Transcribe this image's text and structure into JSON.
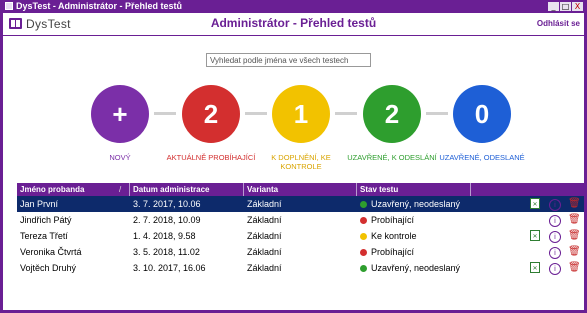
{
  "window": {
    "title": "DysTest - Administrátor - Přehled testů",
    "buttons": {
      "minimize": "_",
      "maximize": "□",
      "close": "X"
    }
  },
  "header": {
    "logo": "DysTest",
    "title": "Administrátor - Přehled testů",
    "logout": "Odhlásit se"
  },
  "search": {
    "placeholder": "Vyhledat podle jména ve všech testech",
    "value": ""
  },
  "status_steps": [
    {
      "symbol": "+",
      "label": "NOVÝ",
      "color": "#7b2fa8",
      "label_color": "#7b2fa8"
    },
    {
      "symbol": "2",
      "label": "AKTUÁLNĚ PROBÍHAJÍCÍ",
      "color": "#d32f2f",
      "label_color": "#d32f2f"
    },
    {
      "symbol": "1",
      "label": "K DOPLNĚNÍ, KE KONTROLE",
      "color": "#f2c200",
      "label_color": "#d9a400"
    },
    {
      "symbol": "2",
      "label": "UZAVŘENÉ, K ODESLÁNÍ",
      "color": "#2e9e2e",
      "label_color": "#2e9e2e"
    },
    {
      "symbol": "0",
      "label": "UZAVŘENÉ, ODESLANÉ",
      "color": "#1e5fd6",
      "label_color": "#1e5fd6"
    }
  ],
  "table": {
    "columns": [
      "Jméno probanda",
      "Datum administrace",
      "Varianta",
      "Stav testu"
    ],
    "sort_mark": "/",
    "rows": [
      {
        "name": "Jan První",
        "date": "3. 7. 2017, 10.06",
        "variant": "Základní",
        "status": "Uzavřený, neodeslaný",
        "status_color": "#2e9e2e",
        "excel": true,
        "selected": true
      },
      {
        "name": "Jindřich Pátý",
        "date": "2. 7. 2018, 10.09",
        "variant": "Základní",
        "status": "Probíhající",
        "status_color": "#d32f2f",
        "excel": false,
        "selected": false
      },
      {
        "name": "Tereza Třetí",
        "date": "1. 4. 2018, 9.58",
        "variant": "Základní",
        "status": "Ke kontrole",
        "status_color": "#f2c200",
        "excel": true,
        "selected": false
      },
      {
        "name": "Veronika Čtvrtá",
        "date": "3. 5. 2018, 11.02",
        "variant": "Základní",
        "status": "Probíhající",
        "status_color": "#d32f2f",
        "excel": false,
        "selected": false
      },
      {
        "name": "Vojtěch Druhý",
        "date": "3. 10. 2017, 16.06",
        "variant": "Základní",
        "status": "Uzavřený, neodeslaný",
        "status_color": "#2e9e2e",
        "excel": true,
        "selected": false
      }
    ],
    "icons": {
      "excel": "xls-export-icon",
      "info": "info-icon",
      "delete": "trash-icon"
    }
  }
}
